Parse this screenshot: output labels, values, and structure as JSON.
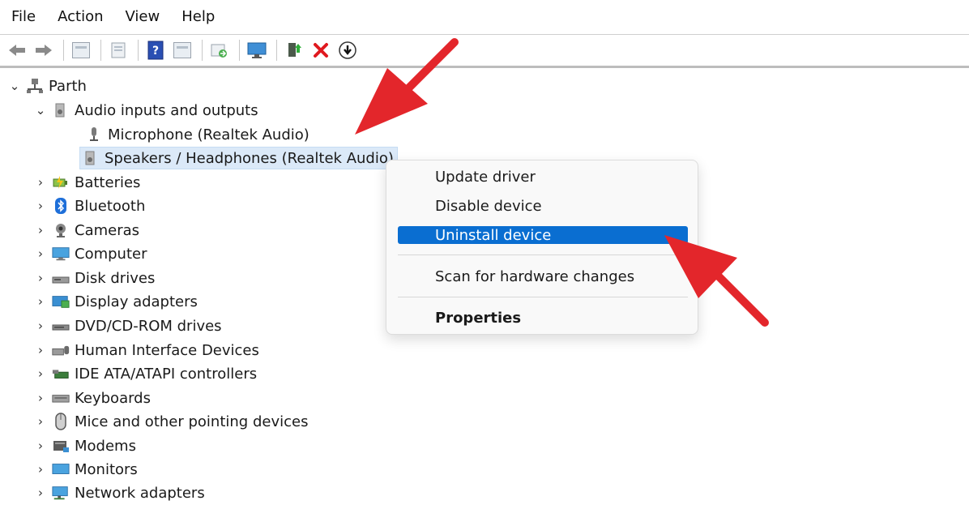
{
  "menubar": {
    "items": [
      "File",
      "Action",
      "View",
      "Help"
    ]
  },
  "toolbar": {
    "buttons": [
      "back-icon",
      "forward-icon",
      "show-hide-console-tree-icon",
      "properties-page-icon",
      "help-icon",
      "action-pane-icon",
      "export-icon",
      "monitor-icon",
      "update-driver-icon",
      "uninstall-icon",
      "download-icon"
    ]
  },
  "tree": {
    "root": "Parth",
    "expanded_category": "Audio inputs and outputs",
    "devices": [
      "Microphone (Realtek Audio)",
      "Speakers / Headphones (Realtek Audio)"
    ],
    "categories": [
      "Batteries",
      "Bluetooth",
      "Cameras",
      "Computer",
      "Disk drives",
      "Display adapters",
      "DVD/CD-ROM drives",
      "Human Interface Devices",
      "IDE ATA/ATAPI controllers",
      "Keyboards",
      "Mice and other pointing devices",
      "Modems",
      "Monitors",
      "Network adapters"
    ]
  },
  "context_menu": {
    "items": [
      "Update driver",
      "Disable device",
      "Uninstall device",
      "Scan for hardware changes",
      "Properties"
    ],
    "highlighted": "Uninstall device"
  },
  "colors": {
    "highlight": "#0a6ed1",
    "annotation_arrow": "#e3262b",
    "selection": "#dbe9f8"
  }
}
